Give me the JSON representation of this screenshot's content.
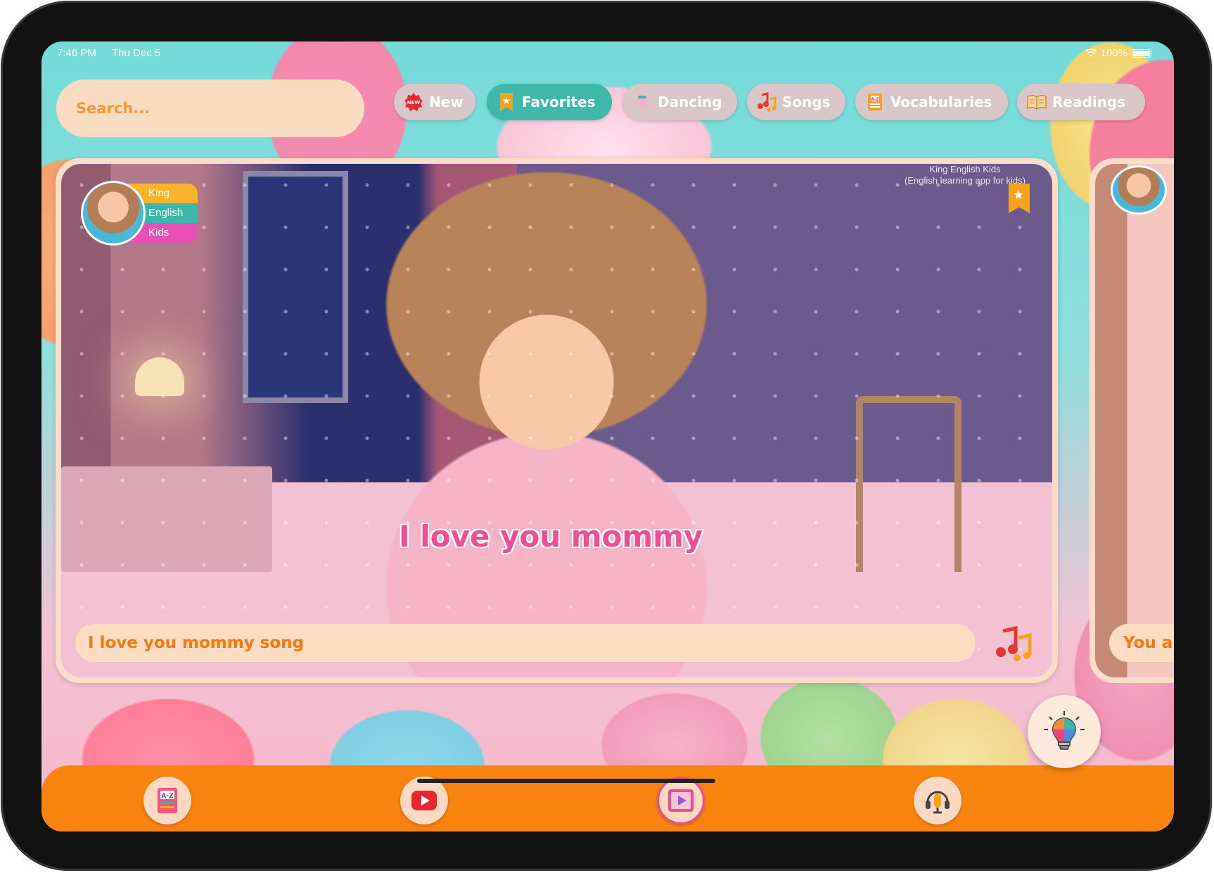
{
  "status_bar": {
    "time": "7:46 PM",
    "date": "Thu Dec 5",
    "battery": "100%"
  },
  "search": {
    "placeholder": "Search..."
  },
  "tabs": [
    {
      "label": "New",
      "icon": "new-badge-icon",
      "active": false
    },
    {
      "label": "Favorites",
      "icon": "star-bookmark-icon",
      "active": true
    },
    {
      "label": "Dancing",
      "icon": "dancing-pig-icon",
      "active": false
    },
    {
      "label": "Songs",
      "icon": "music-notes-icon",
      "active": false
    },
    {
      "label": "Vocabularies",
      "icon": "az-book-icon",
      "active": false
    },
    {
      "label": "Readings",
      "icon": "open-book-icon",
      "active": false
    }
  ],
  "featured": {
    "logo_lines": [
      "King",
      "English",
      "Kids"
    ],
    "watermark_line1": "King English Kids",
    "watermark_line2": "(English learning app for kids)",
    "lyric": "I love you mommy",
    "title": "I love you mommy song"
  },
  "next_card": {
    "title": "You a"
  },
  "bottom_nav": [
    {
      "name": "vocabulary-book-icon"
    },
    {
      "name": "video-play-icon"
    },
    {
      "name": "movie-play-icon"
    },
    {
      "name": "podcast-mic-icon"
    }
  ],
  "colors": {
    "accent_orange": "#f88410",
    "active_tab": "#3fb7a9",
    "title_text": "#f37a12",
    "lyric_pink": "#f04d93"
  }
}
